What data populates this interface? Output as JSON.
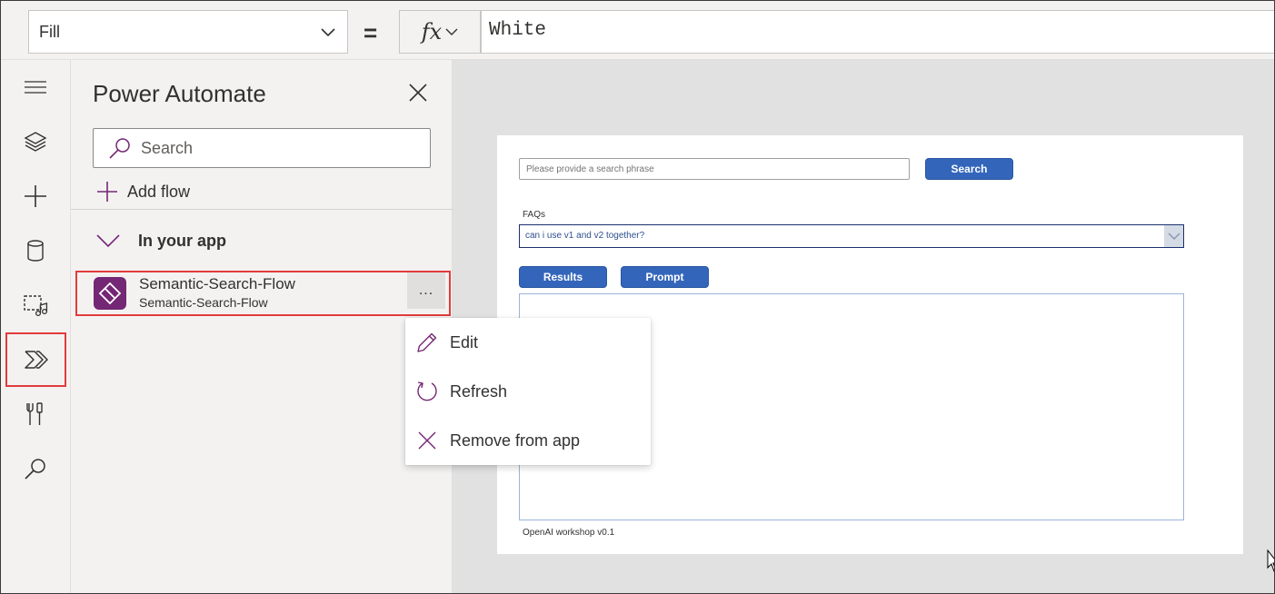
{
  "formula_bar": {
    "property": "Fill",
    "equals": "=",
    "fx_label": "fx",
    "formula": "White"
  },
  "rail": {
    "items": [
      {
        "name": "hamburger-menu",
        "icon": "hamburger-icon"
      },
      {
        "name": "tree-view",
        "icon": "layers-icon"
      },
      {
        "name": "insert",
        "icon": "plus-icon"
      },
      {
        "name": "data",
        "icon": "database-icon"
      },
      {
        "name": "media",
        "icon": "media-icon"
      },
      {
        "name": "power-automate",
        "icon": "power-automate-icon",
        "selected": true
      },
      {
        "name": "advanced-tools",
        "icon": "tools-icon"
      },
      {
        "name": "search",
        "icon": "search-icon"
      }
    ]
  },
  "panel": {
    "title": "Power Automate",
    "search_placeholder": "Search",
    "add_flow_label": "Add flow",
    "section_label": "In your app",
    "flow": {
      "name": "Semantic-Search-Flow",
      "subtitle": "Semantic-Search-Flow",
      "more_label": "..."
    }
  },
  "context_menu": {
    "items": [
      {
        "label": "Edit",
        "icon": "pencil-icon"
      },
      {
        "label": "Refresh",
        "icon": "refresh-icon"
      },
      {
        "label": "Remove from app",
        "icon": "close-icon"
      }
    ]
  },
  "app": {
    "search_placeholder": "Please provide a search phrase",
    "search_button": "Search",
    "faqs_label": "FAQs",
    "faq_selected": "can i use v1 and v2 together?",
    "results_button": "Results",
    "prompt_button": "Prompt",
    "footer": "OpenAI workshop v0.1"
  },
  "colors": {
    "accent_purple": "#742774",
    "highlight_red": "#e23b3b",
    "app_button_blue": "#3366bb"
  }
}
